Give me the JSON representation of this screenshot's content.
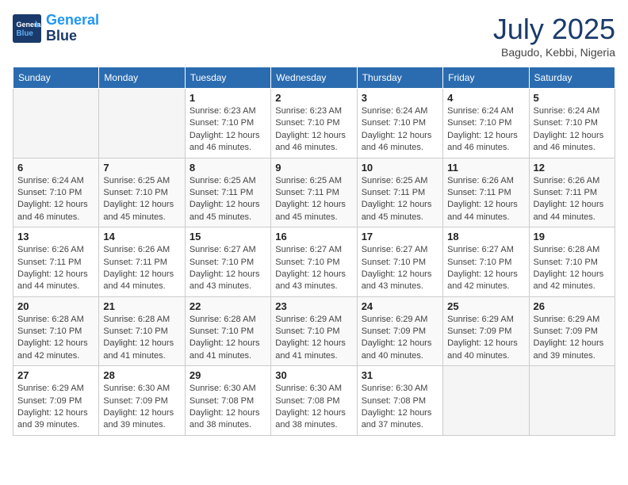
{
  "header": {
    "logo_line1": "General",
    "logo_line2": "Blue",
    "month_title": "July 2025",
    "location": "Bagudo, Kebbi, Nigeria"
  },
  "weekdays": [
    "Sunday",
    "Monday",
    "Tuesday",
    "Wednesday",
    "Thursday",
    "Friday",
    "Saturday"
  ],
  "weeks": [
    [
      {
        "day": "",
        "info": ""
      },
      {
        "day": "",
        "info": ""
      },
      {
        "day": "1",
        "sunrise": "6:23 AM",
        "sunset": "7:10 PM",
        "daylight": "12 hours and 46 minutes."
      },
      {
        "day": "2",
        "sunrise": "6:23 AM",
        "sunset": "7:10 PM",
        "daylight": "12 hours and 46 minutes."
      },
      {
        "day": "3",
        "sunrise": "6:24 AM",
        "sunset": "7:10 PM",
        "daylight": "12 hours and 46 minutes."
      },
      {
        "day": "4",
        "sunrise": "6:24 AM",
        "sunset": "7:10 PM",
        "daylight": "12 hours and 46 minutes."
      },
      {
        "day": "5",
        "sunrise": "6:24 AM",
        "sunset": "7:10 PM",
        "daylight": "12 hours and 46 minutes."
      }
    ],
    [
      {
        "day": "6",
        "sunrise": "6:24 AM",
        "sunset": "7:10 PM",
        "daylight": "12 hours and 46 minutes."
      },
      {
        "day": "7",
        "sunrise": "6:25 AM",
        "sunset": "7:10 PM",
        "daylight": "12 hours and 45 minutes."
      },
      {
        "day": "8",
        "sunrise": "6:25 AM",
        "sunset": "7:11 PM",
        "daylight": "12 hours and 45 minutes."
      },
      {
        "day": "9",
        "sunrise": "6:25 AM",
        "sunset": "7:11 PM",
        "daylight": "12 hours and 45 minutes."
      },
      {
        "day": "10",
        "sunrise": "6:25 AM",
        "sunset": "7:11 PM",
        "daylight": "12 hours and 45 minutes."
      },
      {
        "day": "11",
        "sunrise": "6:26 AM",
        "sunset": "7:11 PM",
        "daylight": "12 hours and 44 minutes."
      },
      {
        "day": "12",
        "sunrise": "6:26 AM",
        "sunset": "7:11 PM",
        "daylight": "12 hours and 44 minutes."
      }
    ],
    [
      {
        "day": "13",
        "sunrise": "6:26 AM",
        "sunset": "7:11 PM",
        "daylight": "12 hours and 44 minutes."
      },
      {
        "day": "14",
        "sunrise": "6:26 AM",
        "sunset": "7:11 PM",
        "daylight": "12 hours and 44 minutes."
      },
      {
        "day": "15",
        "sunrise": "6:27 AM",
        "sunset": "7:10 PM",
        "daylight": "12 hours and 43 minutes."
      },
      {
        "day": "16",
        "sunrise": "6:27 AM",
        "sunset": "7:10 PM",
        "daylight": "12 hours and 43 minutes."
      },
      {
        "day": "17",
        "sunrise": "6:27 AM",
        "sunset": "7:10 PM",
        "daylight": "12 hours and 43 minutes."
      },
      {
        "day": "18",
        "sunrise": "6:27 AM",
        "sunset": "7:10 PM",
        "daylight": "12 hours and 42 minutes."
      },
      {
        "day": "19",
        "sunrise": "6:28 AM",
        "sunset": "7:10 PM",
        "daylight": "12 hours and 42 minutes."
      }
    ],
    [
      {
        "day": "20",
        "sunrise": "6:28 AM",
        "sunset": "7:10 PM",
        "daylight": "12 hours and 42 minutes."
      },
      {
        "day": "21",
        "sunrise": "6:28 AM",
        "sunset": "7:10 PM",
        "daylight": "12 hours and 41 minutes."
      },
      {
        "day": "22",
        "sunrise": "6:28 AM",
        "sunset": "7:10 PM",
        "daylight": "12 hours and 41 minutes."
      },
      {
        "day": "23",
        "sunrise": "6:29 AM",
        "sunset": "7:10 PM",
        "daylight": "12 hours and 41 minutes."
      },
      {
        "day": "24",
        "sunrise": "6:29 AM",
        "sunset": "7:09 PM",
        "daylight": "12 hours and 40 minutes."
      },
      {
        "day": "25",
        "sunrise": "6:29 AM",
        "sunset": "7:09 PM",
        "daylight": "12 hours and 40 minutes."
      },
      {
        "day": "26",
        "sunrise": "6:29 AM",
        "sunset": "7:09 PM",
        "daylight": "12 hours and 39 minutes."
      }
    ],
    [
      {
        "day": "27",
        "sunrise": "6:29 AM",
        "sunset": "7:09 PM",
        "daylight": "12 hours and 39 minutes."
      },
      {
        "day": "28",
        "sunrise": "6:30 AM",
        "sunset": "7:09 PM",
        "daylight": "12 hours and 39 minutes."
      },
      {
        "day": "29",
        "sunrise": "6:30 AM",
        "sunset": "7:08 PM",
        "daylight": "12 hours and 38 minutes."
      },
      {
        "day": "30",
        "sunrise": "6:30 AM",
        "sunset": "7:08 PM",
        "daylight": "12 hours and 38 minutes."
      },
      {
        "day": "31",
        "sunrise": "6:30 AM",
        "sunset": "7:08 PM",
        "daylight": "12 hours and 37 minutes."
      },
      {
        "day": "",
        "info": ""
      },
      {
        "day": "",
        "info": ""
      }
    ]
  ],
  "labels": {
    "sunrise": "Sunrise:",
    "sunset": "Sunset:",
    "daylight": "Daylight:"
  }
}
